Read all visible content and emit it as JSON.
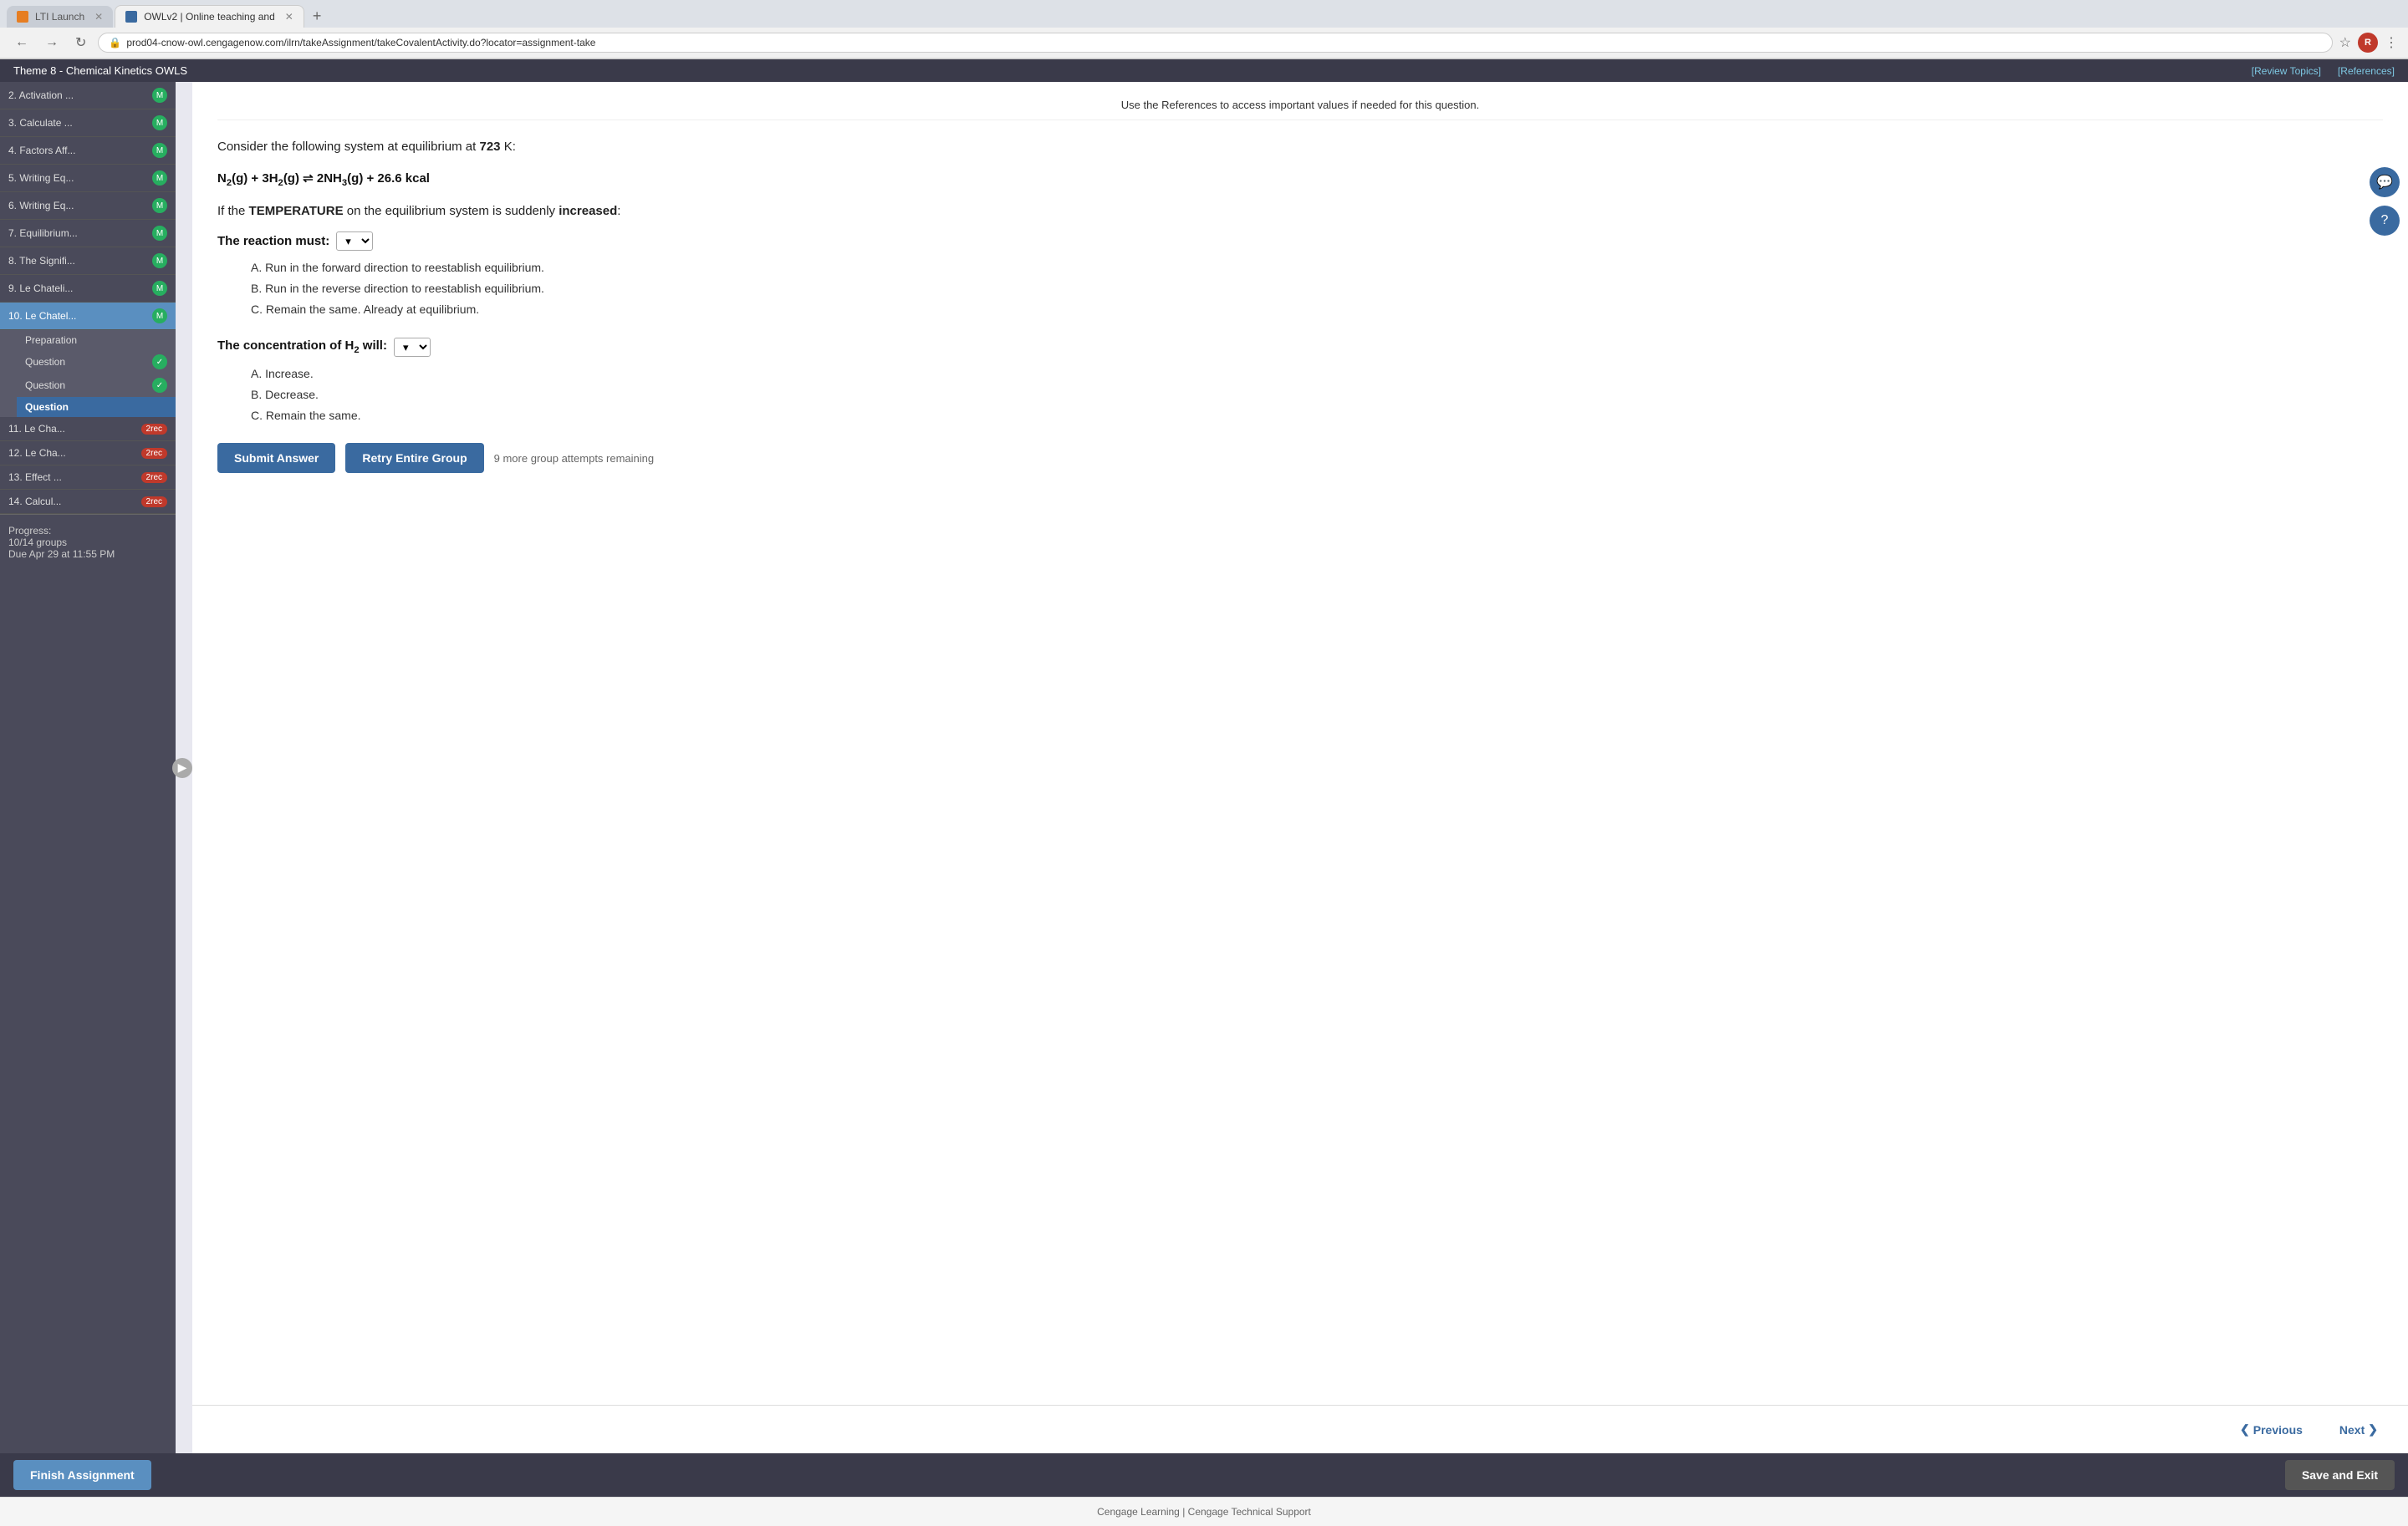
{
  "browser": {
    "tabs": [
      {
        "id": "tab1",
        "label": "LTI Launch",
        "active": false,
        "icon_color": "#e67e22"
      },
      {
        "id": "tab2",
        "label": "OWLv2 | Online teaching and",
        "active": true,
        "icon_color": "#3a6aa0"
      }
    ],
    "url": "prod04-cnow-owl.cengagenow.com/ilrn/takeAssignment/takeCovalentActivity.do?locator=assignment-take",
    "new_tab_label": "+"
  },
  "topbar": {
    "title": "Theme 8 - Chemical Kinetics OWLS",
    "links": [
      {
        "label": "[Review Topics]"
      },
      {
        "label": "[References]"
      }
    ]
  },
  "sidebar": {
    "items": [
      {
        "id": "item2",
        "label": "2. Activation ...",
        "badge": "M",
        "badge_type": "green"
      },
      {
        "id": "item3",
        "label": "3. Calculate ...",
        "badge": "M",
        "badge_type": "green"
      },
      {
        "id": "item4",
        "label": "4. Factors Aff...",
        "badge": "M",
        "badge_type": "green"
      },
      {
        "id": "item5",
        "label": "5. Writing Eq...",
        "badge": "M",
        "badge_type": "green"
      },
      {
        "id": "item6",
        "label": "6. Writing Eq...",
        "badge": "M",
        "badge_type": "green"
      },
      {
        "id": "item7",
        "label": "7. Equilibrium...",
        "badge": "M",
        "badge_type": "green"
      },
      {
        "id": "item8",
        "label": "8. The Signifi...",
        "badge": "M",
        "badge_type": "green"
      },
      {
        "id": "item9",
        "label": "9. Le Chateli...",
        "badge": "M",
        "badge_type": "green"
      },
      {
        "id": "item10",
        "label": "10. Le Chatel...",
        "badge": "M",
        "badge_type": "green",
        "active": true
      }
    ],
    "sub_items_10": [
      {
        "label": "Preparation",
        "active": false
      },
      {
        "label": "Question",
        "active": false,
        "badge": "check"
      },
      {
        "label": "Question",
        "active": false,
        "badge": "check"
      },
      {
        "label": "Question",
        "active": true
      }
    ],
    "items_after": [
      {
        "id": "item11",
        "label": "11. Le Cha...",
        "attempts": "2rec"
      },
      {
        "id": "item12",
        "label": "12. Le Cha...",
        "attempts": "2rec"
      },
      {
        "id": "item13",
        "label": "13. Effect ...",
        "attempts": "2rec"
      },
      {
        "id": "item14",
        "label": "14. Calcul...",
        "attempts": "2rec"
      }
    ],
    "progress": {
      "label": "Progress:",
      "groups": "10/14 groups",
      "due": "Due Apr 29 at",
      "time": "11:55 PM"
    }
  },
  "main": {
    "reference_note": "Use the References to access important values if needed for this question.",
    "question_intro": "Consider the following system at equilibrium at",
    "question_temp": "723",
    "question_unit": "K:",
    "equation": {
      "left": "N",
      "left_sub": "2",
      "left_state": "(g) + 3H",
      "h_sub": "2",
      "h_state": "(g)",
      "arrow": "⇌",
      "right": "2NH",
      "nh_sub": "3",
      "right_state": "(g) + 26.6 kcal"
    },
    "condition_intro": "If the",
    "condition_keyword": "TEMPERATURE",
    "condition_rest": "on the equilibrium system is suddenly",
    "condition_result": "increased",
    "q1_prompt": "The reaction must:",
    "q1_options": [
      "A. Run in the forward direction to reestablish equilibrium.",
      "B. Run in the reverse direction to reestablish equilibrium.",
      "C. Remain the same. Already at equilibrium."
    ],
    "q2_prompt_pre": "The concentration of H",
    "q2_h_sub": "2",
    "q2_prompt_post": " will:",
    "q2_options": [
      "A. Increase.",
      "B. Decrease.",
      "C. Remain the same."
    ],
    "buttons": {
      "submit": "Submit Answer",
      "retry": "Retry Entire Group",
      "attempts_remaining": "9 more group attempts remaining"
    },
    "nav": {
      "previous": "Previous",
      "next": "Next"
    }
  },
  "footer_bar": {
    "finish": "Finish Assignment",
    "save_exit": "Save and Exit"
  },
  "footer": {
    "brand": "Cengage Learning",
    "separator": "|",
    "support": "Cengage Technical Support"
  },
  "right_buttons": {
    "chat": "💬",
    "help": "?"
  }
}
